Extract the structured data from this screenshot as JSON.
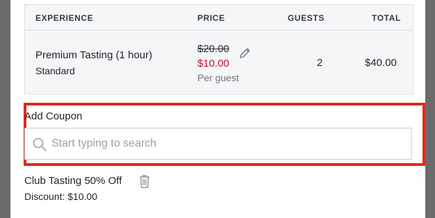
{
  "table": {
    "headers": {
      "experience": "EXPERIENCE",
      "price": "PRICE",
      "guests": "GUESTS",
      "total": "TOTAL"
    },
    "row": {
      "name": "Premium Tasting (1 hour)",
      "tier": "Standard",
      "original_price": "$20.00",
      "sale_price": "$10.00",
      "price_note": "Per guest",
      "guests": "2",
      "total": "$40.00"
    }
  },
  "coupon": {
    "label": "Add Coupon",
    "placeholder": "Start typing to search",
    "applied_name": "Club Tasting 50% Off",
    "discount": "Discount: $10.00"
  },
  "icons": {
    "edit": "pencil-icon",
    "search": "search-icon",
    "remove": "trash-icon"
  },
  "colors": {
    "sale": "#c8102e",
    "highlight_box": "#e02a1d"
  }
}
